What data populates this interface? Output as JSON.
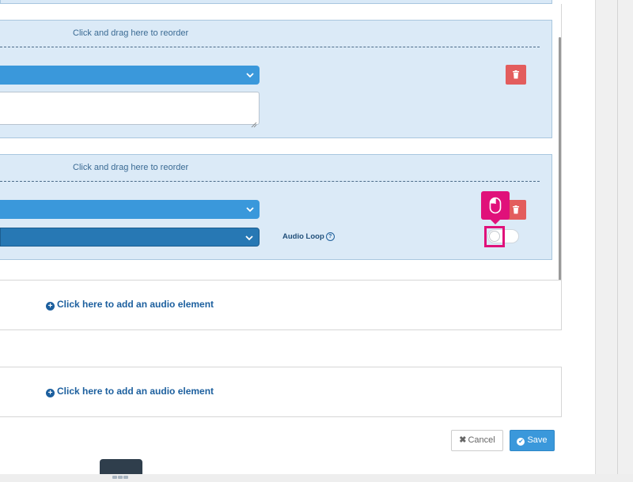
{
  "blocks": [
    {
      "drag_hint": "Click and drag here to reorder"
    },
    {
      "drag_hint": "Click and drag here to reorder",
      "audio_loop_label": "Audio Loop",
      "audio_loop_enabled": false
    }
  ],
  "add_cards": [
    {
      "label": "Click here to add an audio element"
    },
    {
      "label": "Click here to add an audio element"
    }
  ],
  "footer": {
    "cancel_label": "Cancel",
    "save_label": "Save"
  },
  "icons": {
    "delete": "trash-icon",
    "help": "question-circle-icon",
    "add": "plus-circle-icon",
    "cancel": "times-icon",
    "save": "check-circle-icon",
    "cursor": "mouse-icon"
  },
  "colors": {
    "accent": "#3a98db",
    "block_bg": "#dbeaf7",
    "delete": "#e35d5d",
    "highlight": "#e0117a",
    "link": "#1c5f9e"
  }
}
